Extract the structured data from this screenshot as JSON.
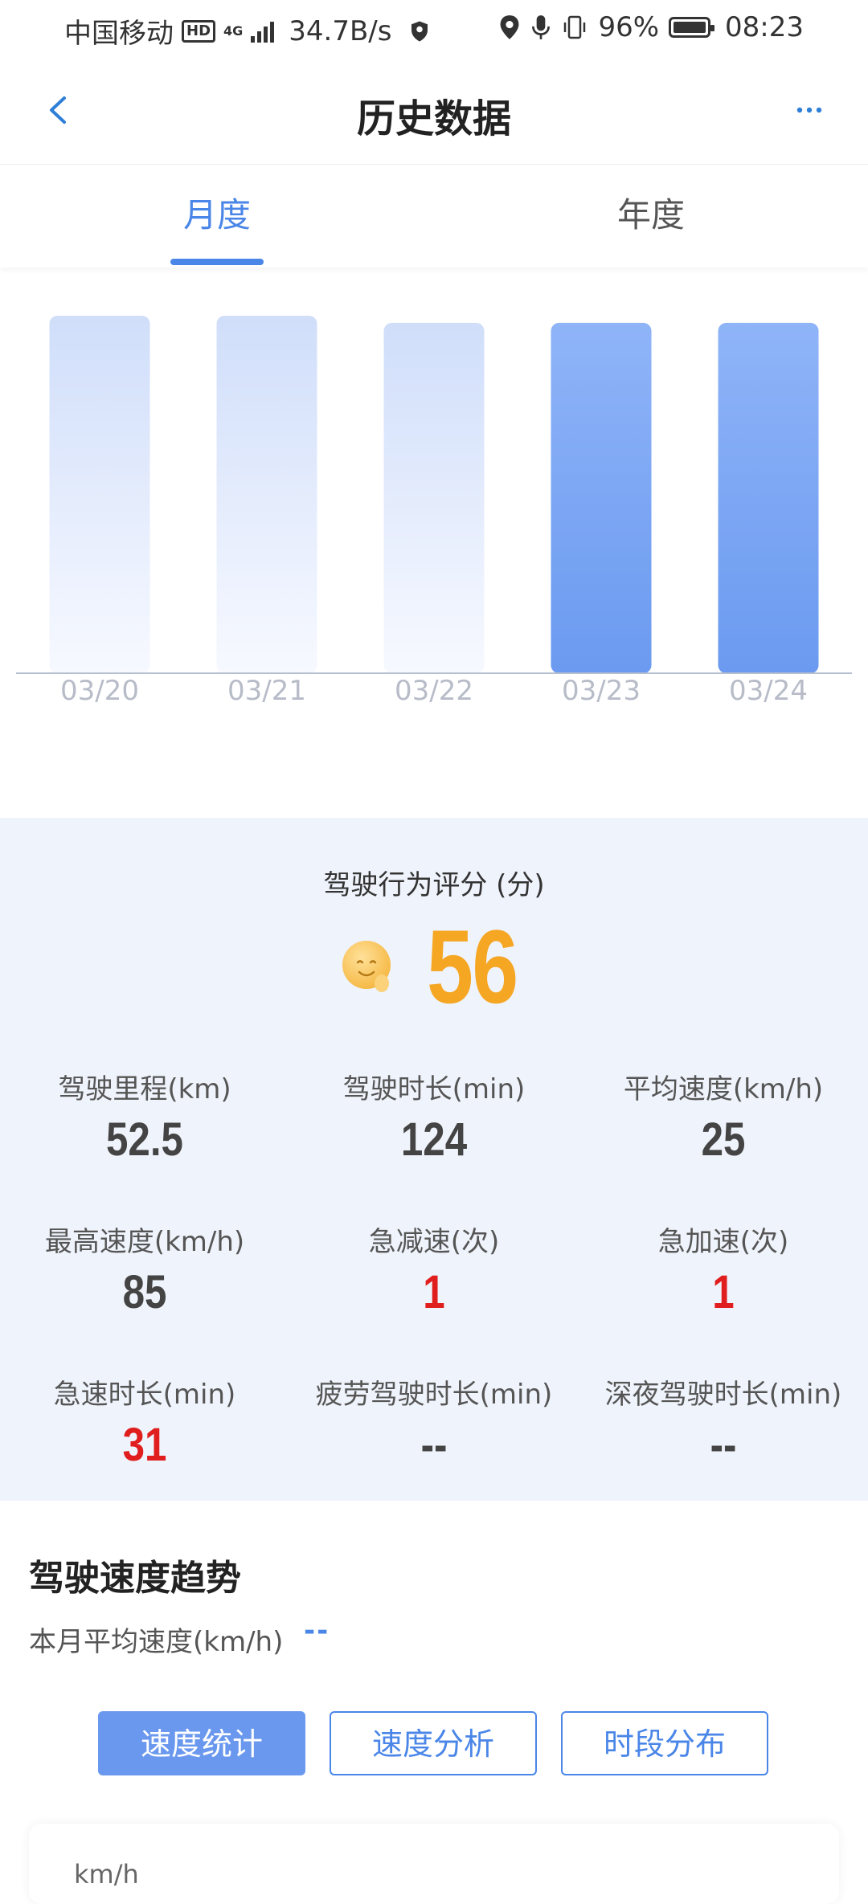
{
  "status_bar": {
    "carrier": "中国移动",
    "hd": "HD",
    "network": "4G",
    "net_speed": "34.7B/s",
    "battery": "96%",
    "time": "08:23"
  },
  "nav": {
    "title": "历史数据",
    "back_icon": "chevron-left-icon",
    "more_icon": "more-dots-icon"
  },
  "tabs": [
    {
      "label": "月度",
      "active": true
    },
    {
      "label": "年度",
      "active": false
    }
  ],
  "chart_data": {
    "type": "bar",
    "categories": [
      "03/20",
      "03/21",
      "03/22",
      "03/23",
      "03/24"
    ],
    "values": [
      100,
      100,
      98,
      98,
      98
    ],
    "highlighted": [
      false,
      false,
      false,
      true,
      true
    ],
    "title": "",
    "xlabel": "",
    "ylabel": "",
    "ylim": [
      0,
      100
    ],
    "grid": false,
    "colors": {
      "highlight_top": "#8fb4f8",
      "highlight_bottom": "#6b9af0",
      "faded_top": "#d0defa",
      "faded_bottom": "#f7f9ff",
      "axis": "#b7bfcf"
    }
  },
  "score": {
    "title": "驾驶行为评分 (分)",
    "value": "56",
    "icon": "smiley-face-icon"
  },
  "stats": [
    {
      "label": "驾驶里程(km)",
      "value": "52.5",
      "alert": false
    },
    {
      "label": "驾驶时长(min)",
      "value": "124",
      "alert": false
    },
    {
      "label": "平均速度(km/h)",
      "value": "25",
      "alert": false
    },
    {
      "label": "最高速度(km/h)",
      "value": "85",
      "alert": false
    },
    {
      "label": "急减速(次)",
      "value": "1",
      "alert": true
    },
    {
      "label": "急加速(次)",
      "value": "1",
      "alert": true
    },
    {
      "label": "急速时长(min)",
      "value": "31",
      "alert": true
    },
    {
      "label": "疲劳驾驶时长(min)",
      "value": "--",
      "alert": false
    },
    {
      "label": "深夜驾驶时长(min)",
      "value": "--",
      "alert": false
    }
  ],
  "trend": {
    "title": "驾驶速度趋势",
    "avg_label": "本月平均速度(km/h)",
    "avg_value": "--",
    "segments": [
      {
        "label": "速度统计",
        "active": true
      },
      {
        "label": "速度分析",
        "active": false
      },
      {
        "label": "时段分布",
        "active": false
      }
    ],
    "card_unit": "km/h"
  },
  "colors": {
    "accent": "#4a86e8",
    "score": "#f5a623",
    "alert": "#e01e1e",
    "panel_bg": "#eff3fb"
  }
}
